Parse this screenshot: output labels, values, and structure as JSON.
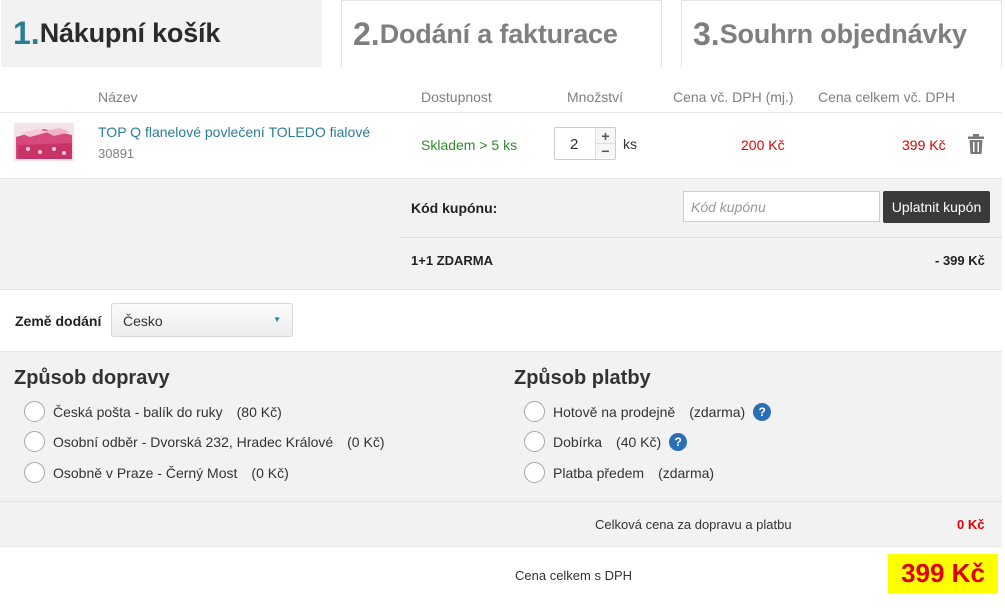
{
  "steps": [
    {
      "num": "1.",
      "label": "Nákupní košík"
    },
    {
      "num": "2.",
      "label": "Dodání a fakturace"
    },
    {
      "num": "3.",
      "label": "Souhrn objednávky"
    }
  ],
  "table_headers": {
    "name": "Název",
    "availability": "Dostupnost",
    "quantity": "Množství",
    "unit_price": "Cena vč. DPH (mj.)",
    "total_price": "Cena celkem vč. DPH"
  },
  "product": {
    "name": "TOP Q flanelové povlečení TOLEDO fialové",
    "code": "30891",
    "stock": "Skladem > 5 ks",
    "quantity": "2",
    "qty_plus": "+",
    "qty_minus": "−",
    "unit": "ks",
    "unit_price": "200 Kč",
    "total_price": "399 Kč",
    "image_icon": "bedding-product-thumbnail",
    "delete_icon": "trash-icon"
  },
  "coupon": {
    "label": "Kód kupónu:",
    "placeholder": "Kód kupónu",
    "button": "Uplatnit kupón"
  },
  "discount": {
    "label": "1+1 ZDARMA",
    "value": "- 399 Kč"
  },
  "country": {
    "label": "Země dodání",
    "selected": "Česko"
  },
  "shipping": {
    "title": "Způsob dopravy",
    "options": [
      {
        "label": "Česká pošta - balík do ruky",
        "price": "(80 Kč)"
      },
      {
        "label": "Osobní odběr - Dvorská 232, Hradec Králové",
        "price": "(0 Kč)"
      },
      {
        "label": "Osobně v Praze - Černý Most",
        "price": "(0 Kč)"
      }
    ]
  },
  "payment": {
    "title": "Způsob platby",
    "options": [
      {
        "label": "Hotově na prodejně",
        "price": "(zdarma)",
        "help": "?"
      },
      {
        "label": "Dobírka",
        "price": "(40 Kč)",
        "help": "?"
      },
      {
        "label": "Platba předem",
        "price": "(zdarma)"
      }
    ]
  },
  "totals": {
    "shipping_payment_label": "Celková cena za dopravu a platbu",
    "shipping_payment_value": "0 Kč",
    "grand_label": "Cena celkem s DPH",
    "grand_value": "399 Kč"
  },
  "colors": {
    "accent": "#2b7d95",
    "price_red": "#e00000",
    "stock_green": "#2f8a2f",
    "highlight": "#ffff00"
  }
}
